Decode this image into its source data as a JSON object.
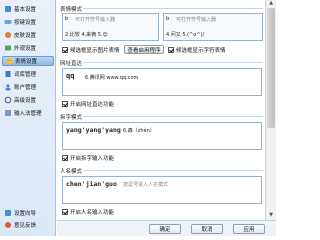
{
  "sidebar": {
    "items": [
      {
        "label": "基本设置",
        "icon": "basic-settings-icon"
      },
      {
        "label": "按键设置",
        "icon": "keyboard-icon"
      },
      {
        "label": "皮肤设置",
        "icon": "skin-icon"
      },
      {
        "label": "外观设置",
        "icon": "appearance-icon"
      },
      {
        "label": "表情设置",
        "icon": "emoticon-icon"
      },
      {
        "label": "词库管理",
        "icon": "dictionary-icon"
      },
      {
        "label": "账户管理",
        "icon": "account-icon"
      },
      {
        "label": "高级设置",
        "icon": "advanced-icon"
      },
      {
        "label": "输入法管理",
        "icon": "ime-manage-icon"
      }
    ],
    "selected_index": 4,
    "bottom": [
      {
        "label": "设置向导",
        "icon": "wizard-icon"
      },
      {
        "label": "意见反馈",
        "icon": "feedback-icon"
      }
    ]
  },
  "sections": {
    "emoji": {
      "title": "表情模式",
      "preview1": {
        "input": "b",
        "hint": "可打开符号输入器",
        "cands": "2.比较  4.来俩  5.😊"
      },
      "preview2": {
        "input": "b",
        "hint": "可打开符号输入器",
        "cands": "4.问又  5.(^o^)/"
      },
      "check1": "候选框显示图片表情",
      "btn": "查看启用程序",
      "check2": "候选框显示字符表情"
    },
    "url": {
      "title": "网址直达",
      "input": "qq",
      "cand": "6.腾讯网  www.qq.com",
      "check": "开启网址直达功能"
    },
    "pinyin": {
      "title": "拆字模式",
      "input": "yang'yang'yang",
      "cand": "6.森（zhèn）",
      "check": "开启拆字输入功能"
    },
    "name": {
      "title": "人名模式",
      "input": "chen'jian'guo",
      "hint": "按逗号进入人名模式",
      "check": "开启人名输入功能"
    }
  },
  "footer": {
    "ok": "确定",
    "cancel": "取消",
    "apply": "应用"
  },
  "colors": {
    "sidebar_bg": "#dbe8f6",
    "selected": "#8fb9e6",
    "border": "#9db2c8"
  }
}
